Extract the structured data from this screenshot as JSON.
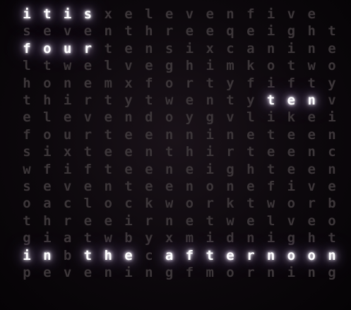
{
  "title": "",
  "grid": {
    "rows": [
      "itisxelevenfive",
      "seventhreeqeight",
      "fourtensixcanine",
      "ltwelveghimkotwo",
      "honemxfortyfifty",
      "thirtytwentytenv",
      "elevendoygvlikei",
      "fourteennineteen",
      "sixteenthirteenc",
      "wfifteeneighteen",
      "seventeenonefive",
      "oaclockworktworb",
      "threeirnetwelveo",
      "giatwbyxmidnight",
      "inbthecafternoon",
      "peveningfmorning"
    ],
    "lit": [
      [
        0,
        1,
        2,
        3
      ],
      [],
      [
        0,
        1,
        2,
        3
      ],
      [],
      [],
      [
        12,
        13,
        14
      ],
      [],
      [],
      [],
      [],
      [],
      [],
      [],
      [],
      [
        0,
        1,
        3,
        4,
        5,
        7,
        8,
        9,
        10,
        11,
        12,
        13,
        14,
        15
      ],
      []
    ],
    "active_words": [
      "it",
      "is",
      "four",
      "ten",
      "in",
      "the",
      "afternoon"
    ],
    "colors": {
      "lit": "#ffffff",
      "dim": "#3c3639",
      "glow": "#b8a0e0",
      "background": "#050305"
    }
  }
}
